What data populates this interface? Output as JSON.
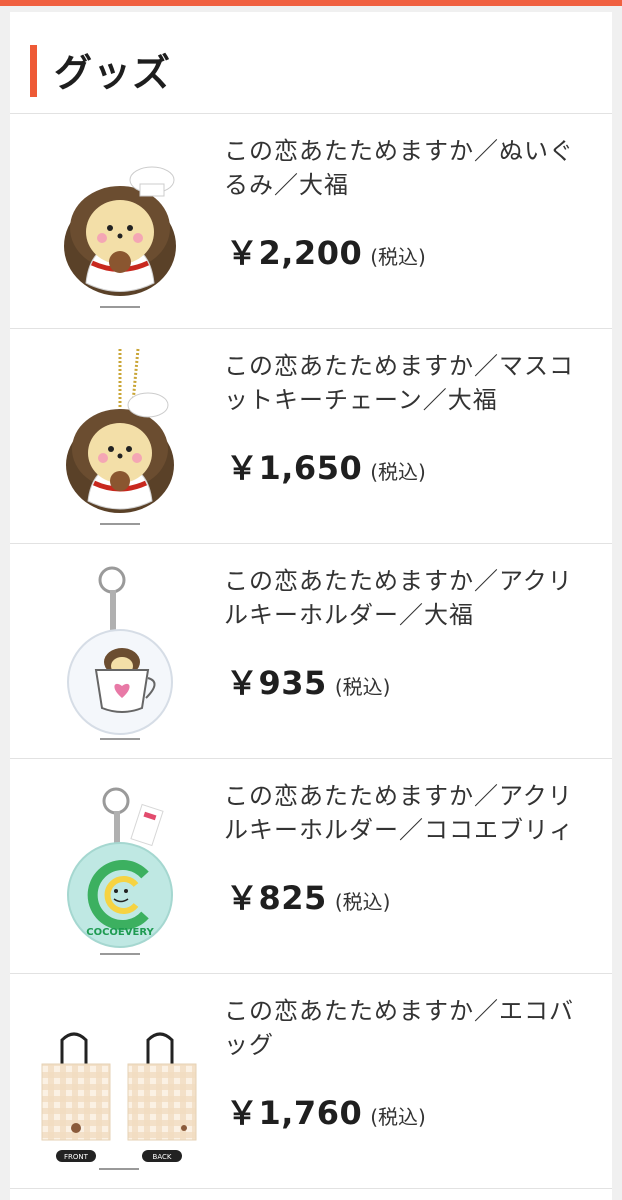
{
  "section": {
    "title": "グッズ"
  },
  "products": [
    {
      "name": "この恋あたためますか／ぬいぐるみ／大福",
      "price": "￥2,200",
      "tax_note": "(税込)",
      "image": "hedgehog-plush-image"
    },
    {
      "name": "この恋あたためますか／マスコットキーチェーン／大福",
      "price": "￥1,650",
      "tax_note": "(税込)",
      "image": "hedgehog-mascot-keychain-image"
    },
    {
      "name": "この恋あたためますか／アクリルキーホルダー／大福",
      "price": "￥935",
      "tax_note": "(税込)",
      "image": "acrylic-keyholder-cup-image"
    },
    {
      "name": "この恋あたためますか／アクリルキーホルダー／ココエブリィ",
      "price": "￥825",
      "tax_note": "(税込)",
      "image": "acrylic-keyholder-cocoevery-image",
      "image_text": "COCOEVERY"
    },
    {
      "name": "この恋あたためますか／エコバッグ",
      "price": "￥1,760",
      "tax_note": "(税込)",
      "image": "eco-bag-image",
      "image_labels": [
        "FRONT",
        "BACK"
      ]
    }
  ],
  "colors": {
    "accent": "#ee5a36",
    "top_bar": "#f06040",
    "background": "#f0f0f0"
  }
}
